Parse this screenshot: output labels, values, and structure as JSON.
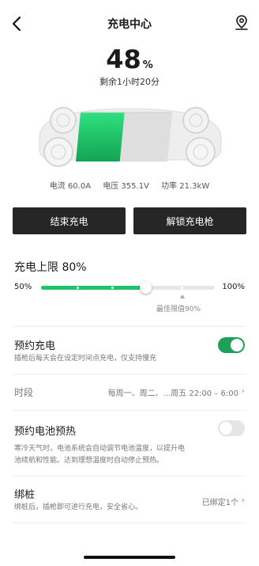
{
  "header": {
    "title": "充电中心",
    "back_icon": "chevron-left-icon",
    "map_icon": "map-pin-icon"
  },
  "battery": {
    "percent": "48",
    "unit": "%",
    "remaining": "剩余1小时20分",
    "level_fraction": 0.48
  },
  "stats": {
    "current": "电流 60.0A",
    "voltage": "电压 355.1V",
    "power": "功率 21.3kW"
  },
  "actions": {
    "stop_label": "结束充电",
    "unlock_label": "解锁充电枪"
  },
  "charge_limit": {
    "title": "充电上限 80%",
    "min_label": "50%",
    "max_label": "100%",
    "value_percent": 80,
    "min_percent": 50,
    "max_percent": 100,
    "best_percent": 90,
    "best_label": "最佳限值90%"
  },
  "scheduled_charge": {
    "title": "预约充电",
    "subtitle": "插枪后每天会在设定时间点充电，仅支持慢充",
    "enabled": true
  },
  "period": {
    "label": "时段",
    "value": "每周一、周二、...周五 22:00 – 6:00"
  },
  "battery_preheat": {
    "title": "预约电池预热",
    "subtitle_line1": "寒冷天气时，电池系统会自动调节电池温度，以提升电",
    "subtitle_line2": "池续航和性能。达到理想温度时自动停止预热。",
    "enabled": false
  },
  "pile": {
    "title": "绑桩",
    "subtitle": "绑桩后，插枪即可进行充电，安全省心。",
    "status": "已绑定1个"
  },
  "colors": {
    "accent_green": "#1fc46a",
    "toggle_green": "#1fa05a",
    "button_dark": "#262626"
  }
}
